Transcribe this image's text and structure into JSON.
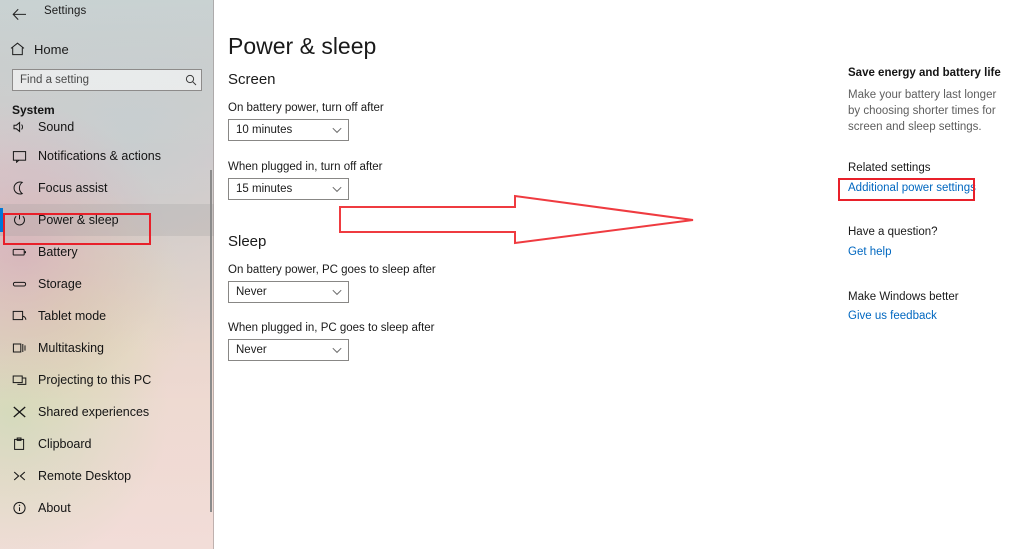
{
  "window": {
    "title": "Settings",
    "back_icon": "back-arrow-icon",
    "controls": {
      "minimize": "—",
      "maximize": "❐",
      "close": "✕"
    }
  },
  "sidebar": {
    "home_label": "Home",
    "home_icon": "home-icon",
    "search": {
      "placeholder": "Find a setting",
      "value": "",
      "icon": "search-icon"
    },
    "category": "System",
    "items": [
      {
        "label": "Sound",
        "icon": "sound-icon",
        "clipped": true,
        "selected": false
      },
      {
        "label": "Notifications & actions",
        "icon": "notifications-icon",
        "selected": false
      },
      {
        "label": "Focus assist",
        "icon": "moon-icon",
        "selected": false
      },
      {
        "label": "Power & sleep",
        "icon": "power-icon",
        "selected": true
      },
      {
        "label": "Battery",
        "icon": "battery-icon",
        "selected": false
      },
      {
        "label": "Storage",
        "icon": "storage-icon",
        "selected": false
      },
      {
        "label": "Tablet mode",
        "icon": "tablet-icon",
        "selected": false
      },
      {
        "label": "Multitasking",
        "icon": "multitasking-icon",
        "selected": false
      },
      {
        "label": "Projecting to this PC",
        "icon": "projecting-icon",
        "selected": false
      },
      {
        "label": "Shared experiences",
        "icon": "shared-experiences-icon",
        "selected": false
      },
      {
        "label": "Clipboard",
        "icon": "clipboard-icon",
        "selected": false
      },
      {
        "label": "Remote Desktop",
        "icon": "remote-desktop-icon",
        "selected": false
      },
      {
        "label": "About",
        "icon": "info-icon",
        "selected": false
      }
    ]
  },
  "main": {
    "page_title": "Power & sleep",
    "screen": {
      "heading": "Screen",
      "battery_label": "On battery power, turn off after",
      "battery_value": "10 minutes",
      "plugged_label": "When plugged in, turn off after",
      "plugged_value": "15 minutes"
    },
    "sleep": {
      "heading": "Sleep",
      "battery_label": "On battery power, PC goes to sleep after",
      "battery_value": "Never",
      "plugged_label": "When plugged in, PC goes to sleep after",
      "plugged_value": "Never"
    }
  },
  "right_panel": {
    "tip_title": "Save energy and battery life",
    "tip_body": "Make your battery last longer by choosing shorter times for screen and sleep settings.",
    "related_title": "Related settings",
    "related_link": "Additional power settings",
    "question_title": "Have a question?",
    "question_link": "Get help",
    "feedback_title": "Make Windows better",
    "feedback_link": "Give us feedback"
  },
  "annotations": {
    "color": "#e8202a",
    "arrow": "red-arrow-pointing-right",
    "boxes": [
      "power-and-sleep-sidebar-item",
      "additional-power-settings-link"
    ]
  },
  "colors": {
    "accent": "#0078d7",
    "link": "#0067c0",
    "annotation_red": "#e8202a",
    "content_background": "#ffffff"
  }
}
